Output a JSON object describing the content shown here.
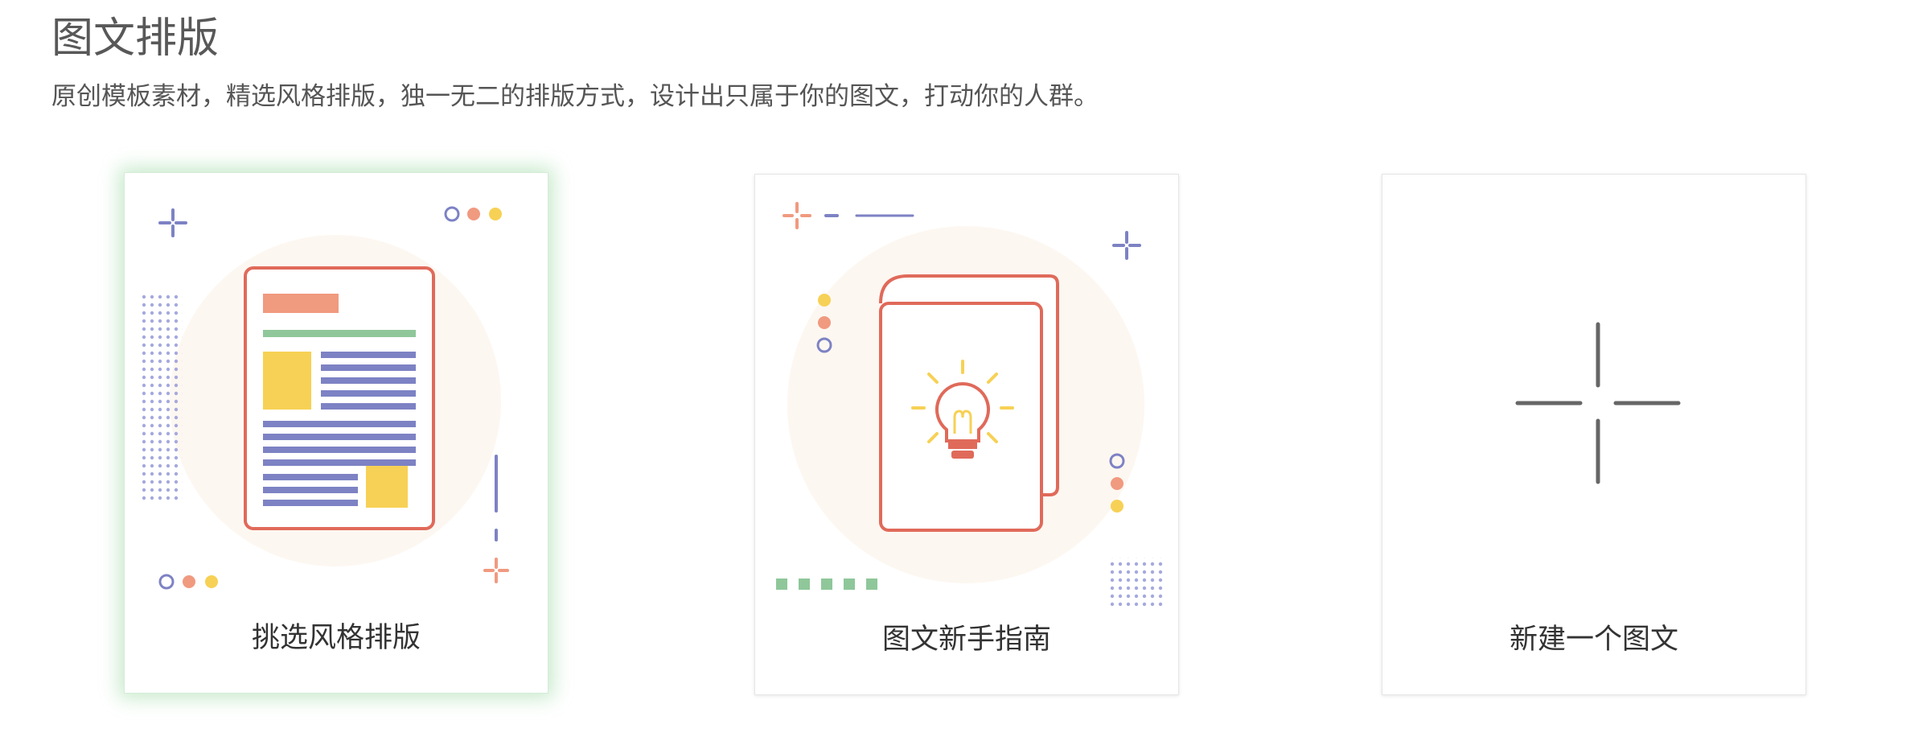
{
  "header": {
    "title": "图文排版",
    "description": "原创模板素材，精选风格排版，独一无二的排版方式，设计出只属于你的图文，打动你的人群。"
  },
  "cards": [
    {
      "label": "挑选风格排版",
      "icon": "layout-document-icon",
      "selected": true
    },
    {
      "label": "图文新手指南",
      "icon": "lightbulb-book-icon",
      "selected": false
    },
    {
      "label": "新建一个图文",
      "icon": "plus-icon",
      "selected": false
    }
  ],
  "colors": {
    "accent_red": "#e06a5a",
    "salmon": "#f09a80",
    "green": "#8fc79a",
    "blue": "#7d82c4",
    "yellow": "#f7d155",
    "circle_bg": "#fdf7f1",
    "selected_glow": "#6ec878"
  }
}
